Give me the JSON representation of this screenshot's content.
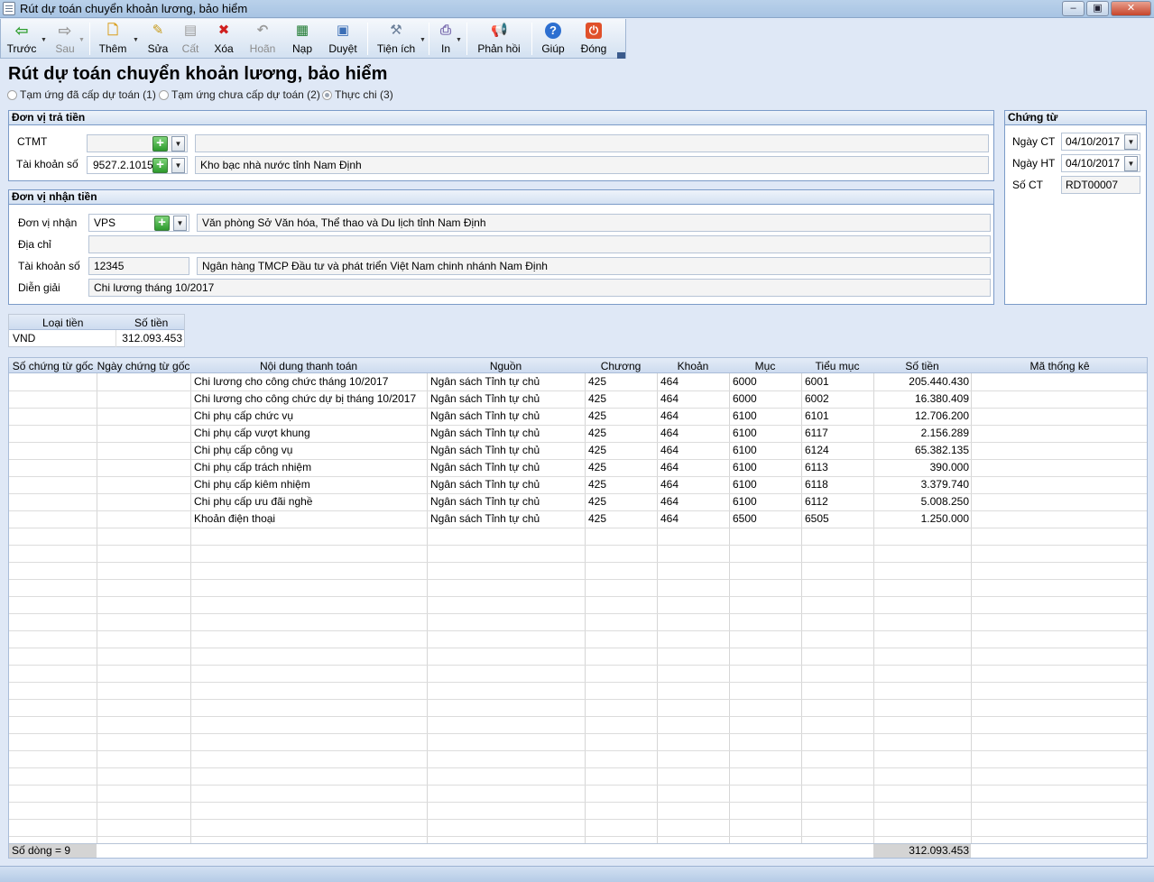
{
  "window": {
    "title": "Rút dự toán chuyển khoản lương, bảo hiểm",
    "minimize": "–",
    "maximize": "▣",
    "close": "✕"
  },
  "toolbar": {
    "back": "Trước",
    "forward": "Sau",
    "add": "Thêm",
    "edit": "Sửa",
    "save": "Cất",
    "delete": "Xóa",
    "undo": "Hoãn",
    "load": "Nạp",
    "approve": "Duyệt",
    "utilities": "Tiện ích",
    "print": "In",
    "feedback": "Phản hồi",
    "help": "Giúp",
    "close": "Đóng"
  },
  "page": {
    "title": "Rút dự toán chuyển khoản lương, bảo hiểm",
    "options": [
      {
        "label": "Tạm ứng đã cấp dự toán (1)",
        "checked": false
      },
      {
        "label": "Tạm ứng chưa cấp dự toán (2)",
        "checked": false
      },
      {
        "label": "Thực chi (3)",
        "checked": true
      }
    ]
  },
  "payer": {
    "heading": "Đơn vị trả tiền",
    "ctmt_label": "CTMT",
    "ctmt_code": "",
    "ctmt_name": "",
    "account_label": "Tài khoản số",
    "account_code": "9527.2.1015(",
    "account_name": "Kho bạc nhà nước tỉnh Nam Định"
  },
  "payee": {
    "heading": "Đơn vị nhận tiền",
    "unit_label": "Đơn vị nhận",
    "unit_code": "VPS",
    "unit_name": "Văn phòng Sở Văn hóa, Thể thao và Du lịch tỉnh Nam Định",
    "address_label": "Địa chỉ",
    "address": "",
    "account_label": "Tài khoản số",
    "account_number": "12345",
    "bank": "Ngân hàng TMCP Đầu tư và phát triển Việt Nam chinh nhánh Nam Định",
    "description_label": "Diễn giải",
    "description": "Chi lương tháng 10/2017"
  },
  "voucher": {
    "heading": "Chứng từ",
    "date_ct_label": "Ngày CT",
    "date_ct": "04/10/2017",
    "date_ht_label": "Ngày HT",
    "date_ht": "04/10/2017",
    "number_label": "Số CT",
    "number": "RDT00007"
  },
  "currency": {
    "headers": [
      "Loại tiền",
      "Số tiền"
    ],
    "type": "VND",
    "amount": "312.093.453"
  },
  "grid": {
    "headers": [
      "Số chứng từ gốc",
      "Ngày chứng từ gốc",
      "Nội dung thanh toán",
      "Nguồn",
      "Chương",
      "Khoản",
      "Mục",
      "Tiểu mục",
      "Số tiền",
      "Mã thống kê"
    ],
    "rows": [
      {
        "content": "Chi lương cho công chức tháng 10/2017",
        "source": "Ngân sách Tỉnh tự chủ",
        "chapter": "425",
        "item": "464",
        "section": "6000",
        "subsection": "6001",
        "amount": "205.440.430"
      },
      {
        "content": "Chi lương cho công chức dự bị tháng 10/2017",
        "source": "Ngân sách Tỉnh tự chủ",
        "chapter": "425",
        "item": "464",
        "section": "6000",
        "subsection": "6002",
        "amount": "16.380.409"
      },
      {
        "content": "Chi phụ cấp chức vụ",
        "source": "Ngân sách Tỉnh tự chủ",
        "chapter": "425",
        "item": "464",
        "section": "6100",
        "subsection": "6101",
        "amount": "12.706.200"
      },
      {
        "content": "Chi phụ cấp vượt khung",
        "source": "Ngân sách Tỉnh tự chủ",
        "chapter": "425",
        "item": "464",
        "section": "6100",
        "subsection": "6117",
        "amount": "2.156.289"
      },
      {
        "content": "Chi phụ cấp công vụ",
        "source": "Ngân sách Tỉnh tự chủ",
        "chapter": "425",
        "item": "464",
        "section": "6100",
        "subsection": "6124",
        "amount": "65.382.135"
      },
      {
        "content": "Chi phụ cấp trách nhiệm",
        "source": "Ngân sách Tỉnh tự chủ",
        "chapter": "425",
        "item": "464",
        "section": "6100",
        "subsection": "6113",
        "amount": "390.000"
      },
      {
        "content": "Chi phụ cấp kiêm nhiệm",
        "source": "Ngân sách Tỉnh tự chủ",
        "chapter": "425",
        "item": "464",
        "section": "6100",
        "subsection": "6118",
        "amount": "3.379.740"
      },
      {
        "content": "Chi phụ cấp ưu đãi nghề",
        "source": "Ngân sách Tỉnh tự chủ",
        "chapter": "425",
        "item": "464",
        "section": "6100",
        "subsection": "6112",
        "amount": "5.008.250"
      },
      {
        "content": "Khoản điện thoại",
        "source": "Ngân sách Tỉnh tự chủ",
        "chapter": "425",
        "item": "464",
        "section": "6500",
        "subsection": "6505",
        "amount": "1.250.000"
      }
    ],
    "footer_count": "Số dòng = 9",
    "footer_total": "312.093.453"
  },
  "icons": {
    "back": "arrow-left-icon",
    "forward": "arrow-right-icon",
    "add": "document-add-icon",
    "edit": "pencil-icon",
    "save": "floppy-icon",
    "delete": "delete-x-icon",
    "undo": "undo-icon",
    "load": "excel-icon",
    "approve": "document-check-icon",
    "utilities": "tools-icon",
    "print": "printer-icon",
    "feedback": "megaphone-icon",
    "help": "help-icon",
    "close": "power-icon"
  },
  "colors": {
    "accent_green": "#2d9a2d",
    "back_green": "#2f9e2f",
    "delete_red": "#d02020",
    "close_red": "#e0502a",
    "help_blue": "#2d6fd0",
    "frame_blue": "#7b9bc8"
  }
}
